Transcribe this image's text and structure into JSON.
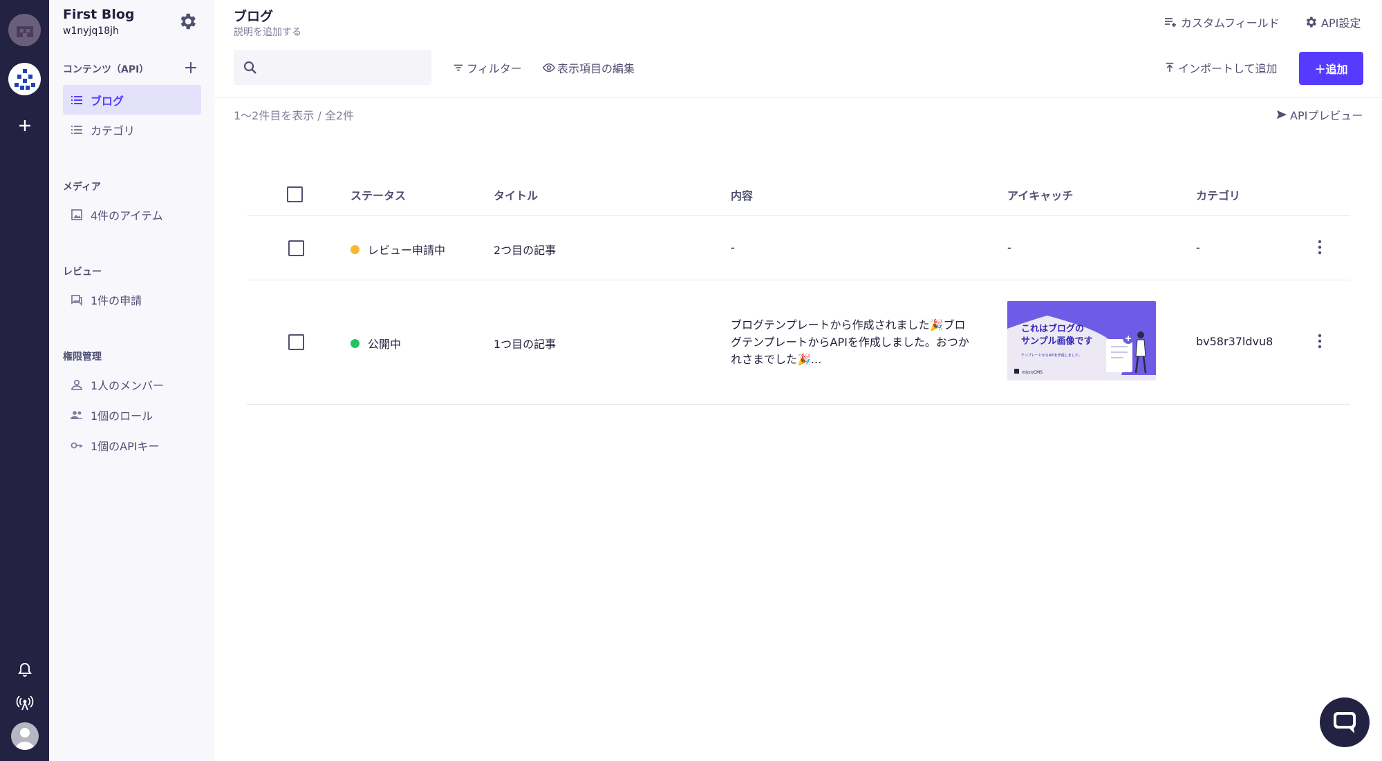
{
  "colors": {
    "accent": "#563bfe",
    "rail": "#232242",
    "status_review": "#f6b92b",
    "status_published": "#22c55e"
  },
  "project": {
    "title": "First Blog",
    "id": "w1nyjq18jh"
  },
  "sidebar": {
    "contents": {
      "label": "コンテンツ（API）",
      "items": [
        {
          "label": "ブログ",
          "icon": "list-icon",
          "active": true
        },
        {
          "label": "カテゴリ",
          "icon": "list-icon",
          "active": false
        }
      ]
    },
    "media": {
      "label": "メディア",
      "items": [
        {
          "label": "4件のアイテム",
          "icon": "image-icon"
        }
      ]
    },
    "review": {
      "label": "レビュー",
      "items": [
        {
          "label": "1件の申請",
          "icon": "review-icon"
        }
      ]
    },
    "permissions": {
      "label": "権限管理",
      "items": [
        {
          "label": "1人のメンバー",
          "icon": "person-icon"
        },
        {
          "label": "1個のロール",
          "icon": "people-icon"
        },
        {
          "label": "1個のAPIキー",
          "icon": "key-icon"
        }
      ]
    }
  },
  "header": {
    "title": "ブログ",
    "description": "説明を追加する",
    "custom_field": "カスタムフィールド",
    "api_settings": "API設定"
  },
  "toolbar": {
    "search_placeholder": "",
    "filter": "フィルター",
    "edit_columns": "表示項目の編集",
    "import": "インポートして追加",
    "add": "＋追加",
    "count": "1〜2件目を表示 / 全2件",
    "api_preview": "APIプレビュー"
  },
  "table": {
    "columns": [
      "ステータス",
      "タイトル",
      "内容",
      "アイキャッチ",
      "カテゴリ"
    ],
    "rows": [
      {
        "status": "レビュー申請中",
        "status_color": "#f6b92b",
        "title": "2つ目の記事",
        "content": "-",
        "eyecatch": "-",
        "category": "-"
      },
      {
        "status": "公開中",
        "status_color": "#22c55e",
        "title": "1つ目の記事",
        "content": "ブログテンプレートから作成されました🎉ブログテンプレートからAPIを作成しました。おつかれさまでした🎉...",
        "eyecatch_image": {
          "heading_line1": "これはブログの",
          "heading_line2": "サンプル画像です",
          "caption": "テンプレートからAPIを作成しました。",
          "brand": "microCMS"
        },
        "category": "bv58r37ldvu8"
      }
    ]
  }
}
